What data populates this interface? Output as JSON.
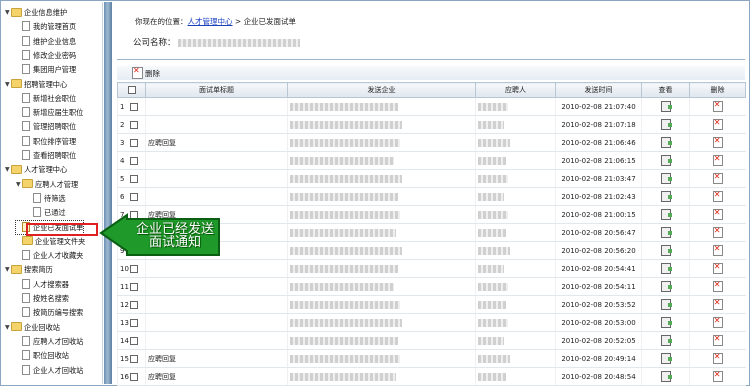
{
  "sidebar": {
    "items": [
      {
        "label": "企业信息维护",
        "level": 0,
        "kind": "folder",
        "arrow": "▼"
      },
      {
        "label": "我的管理首页",
        "level": 1,
        "kind": "doc"
      },
      {
        "label": "维护企业信息",
        "level": 1,
        "kind": "doc"
      },
      {
        "label": "修改企业密码",
        "level": 1,
        "kind": "doc"
      },
      {
        "label": "集团用户管理",
        "level": 1,
        "kind": "doc"
      },
      {
        "label": "招聘管理中心",
        "level": 0,
        "kind": "folder",
        "arrow": "▼"
      },
      {
        "label": "新增社会职位",
        "level": 1,
        "kind": "doc"
      },
      {
        "label": "新增应届生职位",
        "level": 1,
        "kind": "doc"
      },
      {
        "label": "管理招聘职位",
        "level": 1,
        "kind": "doc"
      },
      {
        "label": "职位排序管理",
        "level": 1,
        "kind": "doc"
      },
      {
        "label": "查看招聘职位",
        "level": 1,
        "kind": "doc"
      },
      {
        "label": "人才管理中心",
        "level": 0,
        "kind": "folder",
        "arrow": "▼"
      },
      {
        "label": "应聘人才管理",
        "level": 1,
        "kind": "folder",
        "arrow": "▼"
      },
      {
        "label": "待筛选",
        "level": 2,
        "kind": "doc"
      },
      {
        "label": "已通过",
        "level": 2,
        "kind": "doc"
      },
      {
        "label": "企业已发面试单",
        "level": 1,
        "kind": "doc",
        "selected": true
      },
      {
        "label": "企业管理文件夹",
        "level": 1,
        "kind": "folder"
      },
      {
        "label": "企业人才收藏夹",
        "level": 1,
        "kind": "doc"
      },
      {
        "label": "搜索简历",
        "level": 0,
        "kind": "folder",
        "arrow": "▼"
      },
      {
        "label": "人才搜索器",
        "level": 1,
        "kind": "doc"
      },
      {
        "label": "按姓名搜索",
        "level": 1,
        "kind": "doc"
      },
      {
        "label": "按简历编号搜索",
        "level": 1,
        "kind": "doc"
      },
      {
        "label": "企业回收站",
        "level": 0,
        "kind": "folder",
        "arrow": "▼"
      },
      {
        "label": "应聘人才回收站",
        "level": 1,
        "kind": "doc"
      },
      {
        "label": "职位回收站",
        "level": 1,
        "kind": "doc"
      },
      {
        "label": "企业人才回收站",
        "level": 1,
        "kind": "doc"
      }
    ]
  },
  "breadcrumb": {
    "prefix": "你现在的位置：",
    "link": "人才管理中心",
    "sep": " > ",
    "current": "企业已发面试单"
  },
  "company_label": "公司名称：",
  "toolbar": {
    "delete_label": "删除"
  },
  "table": {
    "headers": [
      "面试单标题",
      "发送企业",
      "应聘人",
      "发送时间",
      "查看",
      "删除"
    ],
    "rows": [
      {
        "n": "1",
        "title": "",
        "time": "2010-02-08 21:07:40"
      },
      {
        "n": "2",
        "title": "",
        "time": "2010-02-08 21:07:18"
      },
      {
        "n": "3",
        "title": "应聘回复",
        "time": "2010-02-08 21:06:46"
      },
      {
        "n": "4",
        "title": "",
        "time": "2010-02-08 21:06:15"
      },
      {
        "n": "5",
        "title": "",
        "time": "2010-02-08 21:03:47"
      },
      {
        "n": "6",
        "title": "",
        "time": "2010-02-08 21:02:43"
      },
      {
        "n": "7",
        "title": "应聘回复",
        "time": "2010-02-08 21:00:15"
      },
      {
        "n": "8",
        "title": "",
        "time": "2010-02-08 20:56:47"
      },
      {
        "n": "9",
        "title": "",
        "time": "2010-02-08 20:56:20"
      },
      {
        "n": "10",
        "title": "",
        "time": "2010-02-08 20:54:41"
      },
      {
        "n": "11",
        "title": "",
        "time": "2010-02-08 20:54:11"
      },
      {
        "n": "12",
        "title": "",
        "time": "2010-02-08 20:53:52"
      },
      {
        "n": "13",
        "title": "",
        "time": "2010-02-08 20:53:00"
      },
      {
        "n": "14",
        "title": "",
        "time": "2010-02-08 20:52:05"
      },
      {
        "n": "15",
        "title": "应聘回复",
        "time": "2010-02-08 20:49:14"
      },
      {
        "n": "16",
        "title": "应聘回复",
        "time": "2010-02-08 20:48:54"
      }
    ]
  },
  "callout": {
    "line1": "企业已经发送",
    "line2": "面试通知",
    "fill": "#1f9a2a",
    "stroke": "#0b5e13"
  }
}
